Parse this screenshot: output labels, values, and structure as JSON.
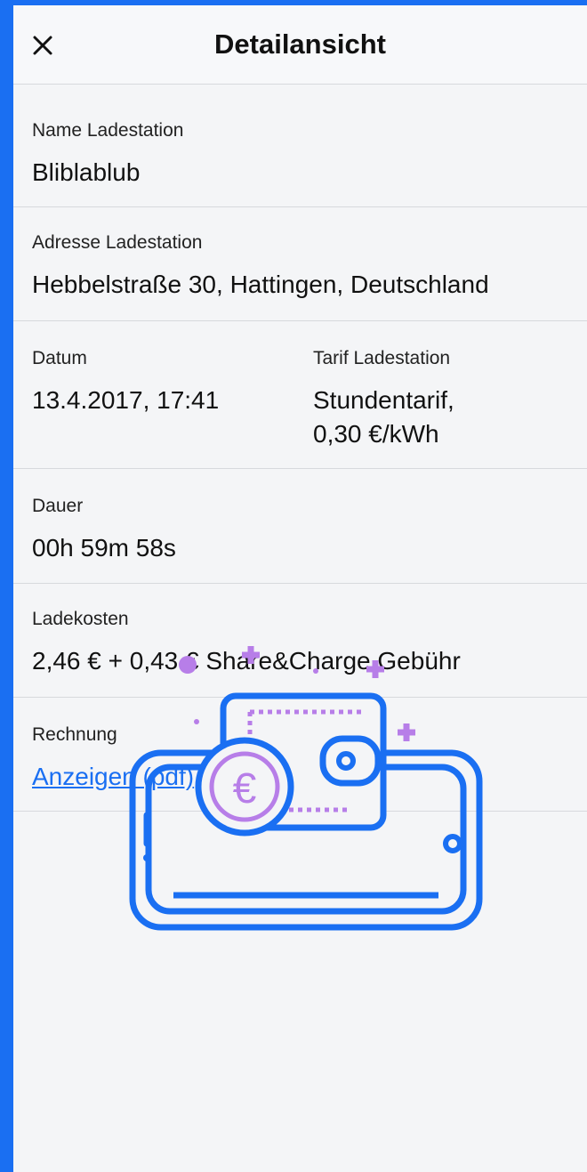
{
  "header": {
    "title": "Detailansicht",
    "close_icon": "close-icon"
  },
  "fields": {
    "name": {
      "label": "Name Ladestation",
      "value": "Bliblablub"
    },
    "address": {
      "label": "Adresse Ladestation",
      "value": "Hebbelstraße 30, Hattingen, Deutschland"
    },
    "date": {
      "label": "Datum",
      "value": "13.4.2017, 17:41"
    },
    "tariff": {
      "label": "Tarif Ladestation",
      "value_line1": "Stundentarif,",
      "value_line2": "0,30 €/kWh"
    },
    "duration": {
      "label": "Dauer",
      "value": "00h 59m 58s"
    },
    "costs": {
      "label": "Ladekosten",
      "value": "2,46 € + 0,43 € Share&Charge Gebühr"
    },
    "invoice": {
      "label": "Rechnung",
      "link": "Anzeigen (pdf)"
    }
  },
  "illustration": {
    "icon": "wallet-phone-euro-icon"
  },
  "colors": {
    "accent": "#1a6ff2",
    "purple": "#b77ee8",
    "background": "#f4f5f7"
  }
}
